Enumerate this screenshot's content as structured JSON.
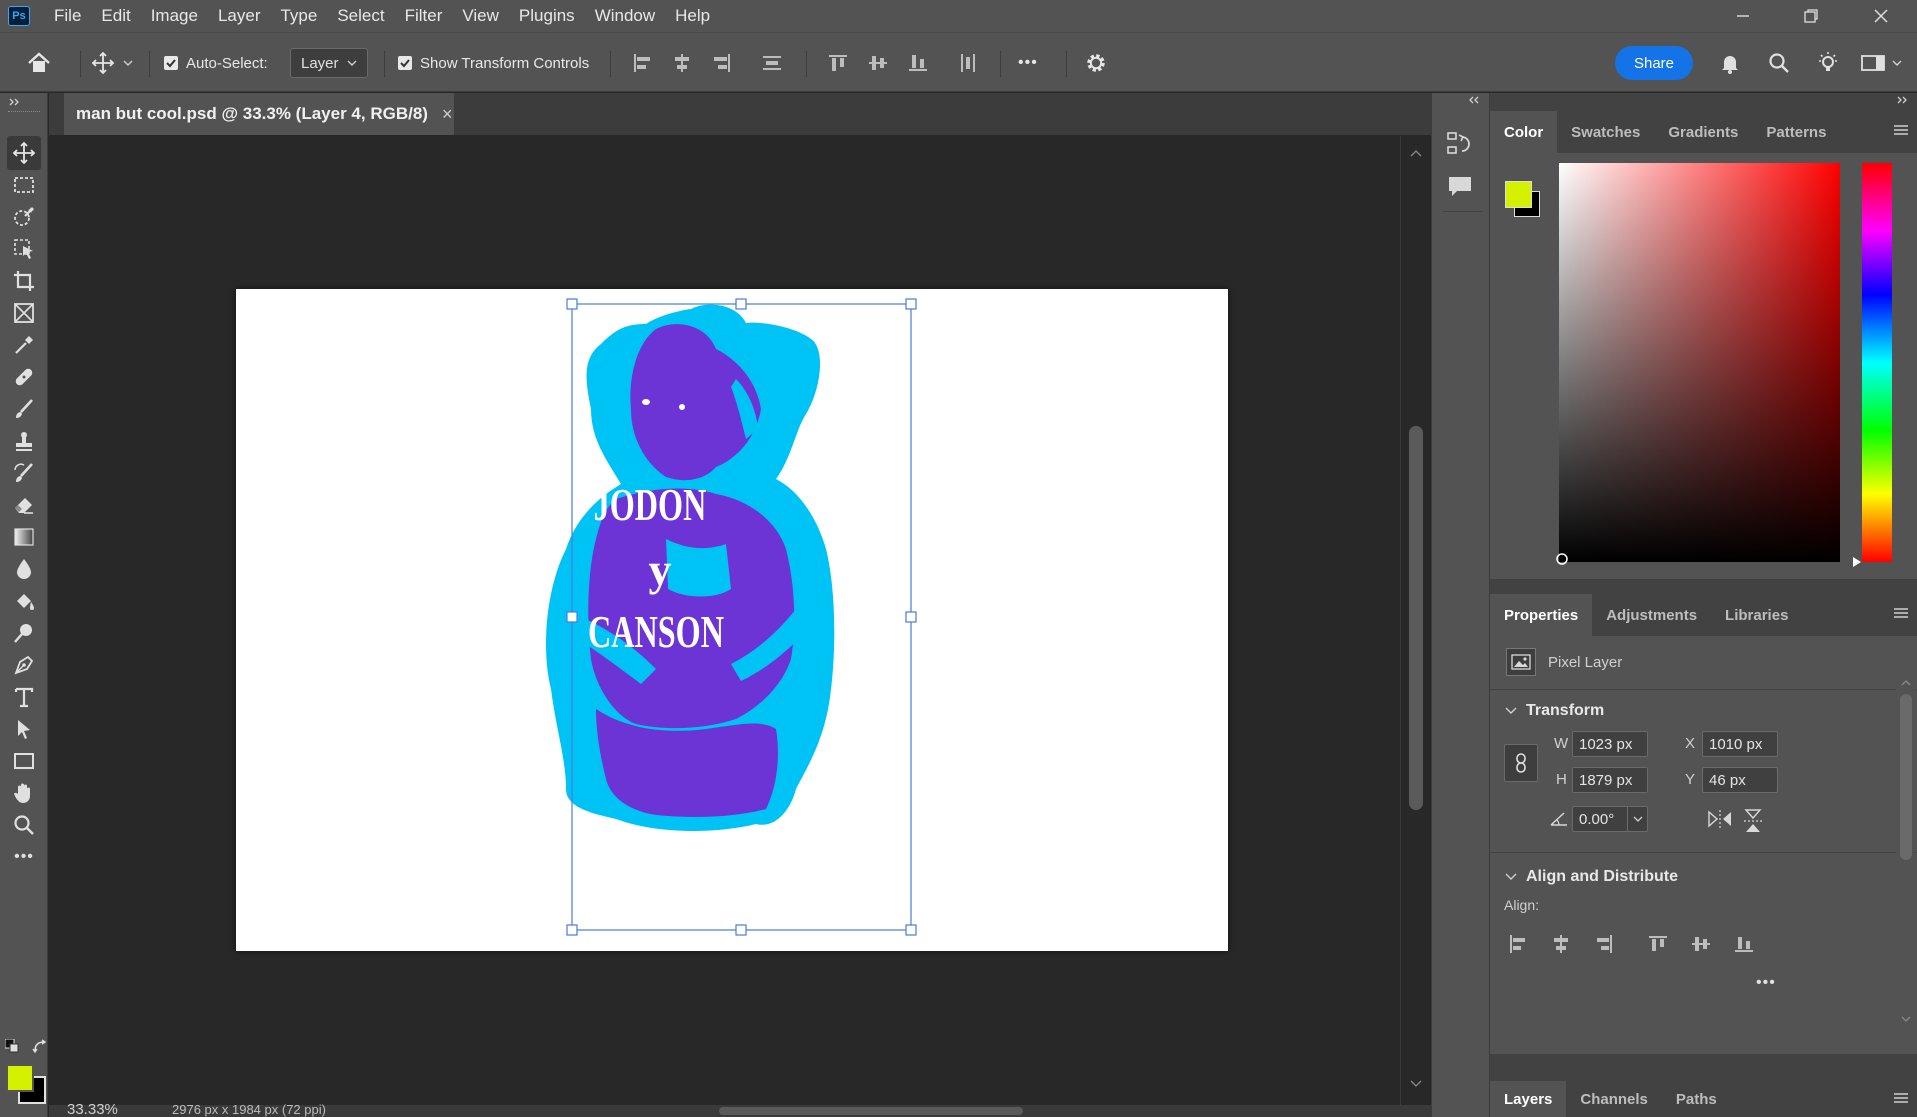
{
  "app": {
    "logo": "Ps"
  },
  "menu": [
    "File",
    "Edit",
    "Image",
    "Layer",
    "Type",
    "Select",
    "Filter",
    "View",
    "Plugins",
    "Window",
    "Help"
  ],
  "options": {
    "auto_select_label": "Auto-Select:",
    "auto_select_checked": true,
    "auto_select_target": "Layer",
    "show_transform_label": "Show Transform Controls",
    "show_transform_checked": true,
    "more": "•••",
    "share_label": "Share"
  },
  "document": {
    "tab_title": "man but cool.psd @ 33.3% (Layer 4, RGB/8)",
    "close": "×",
    "artwork_text": [
      "JODON",
      "y",
      "CANSON"
    ],
    "colors": {
      "primary": "#6c34d4",
      "secondary": "#00c3f5"
    }
  },
  "status": {
    "zoom": "33.33%",
    "doc_info": "2976 px x 1984 px (72 ppi)"
  },
  "toolbar": {
    "more": "•••",
    "foreground_color": "#d4f200",
    "background_color": "#000000"
  },
  "color_panel": {
    "tabs": [
      "Color",
      "Swatches",
      "Gradients",
      "Patterns"
    ],
    "active_tab": "Color",
    "foreground": "#d4f200",
    "background": "#000000",
    "hue": "#ff0000"
  },
  "properties_panel": {
    "tabs": [
      "Properties",
      "Adjustments",
      "Libraries"
    ],
    "active_tab": "Properties",
    "layer_type": "Pixel Layer",
    "transform": {
      "title": "Transform",
      "w_label": "W",
      "w": "1023 px",
      "h_label": "H",
      "h": "1879 px",
      "x_label": "X",
      "x": "1010 px",
      "y_label": "Y",
      "y": "46 px",
      "angle": "0.00°"
    },
    "align": {
      "title": "Align and Distribute",
      "label": "Align:",
      "more": "•••"
    }
  },
  "layers_panel": {
    "tabs": [
      "Layers",
      "Channels",
      "Paths"
    ],
    "active_tab": "Layers"
  }
}
